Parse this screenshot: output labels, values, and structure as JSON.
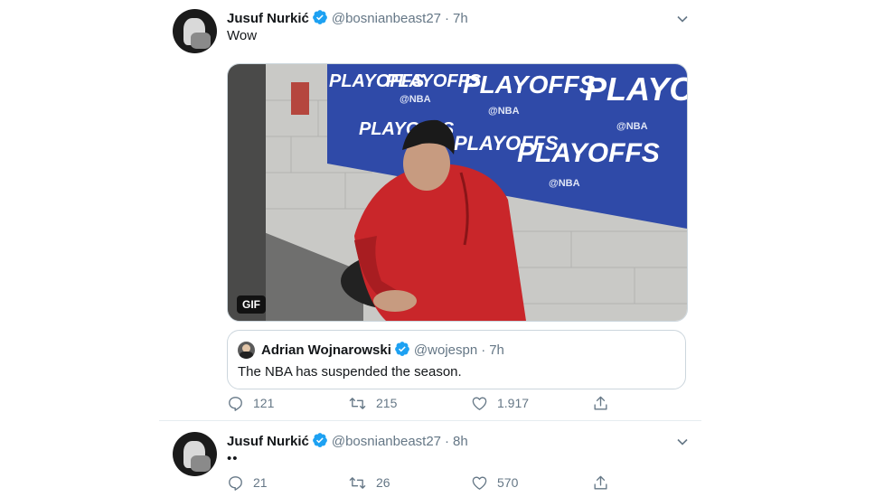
{
  "tweets": [
    {
      "author": "Jusuf Nurkić",
      "handle": "@bosnianbeast27",
      "separator": "·",
      "time": "7h",
      "text": "Wow",
      "media": {
        "badge": "GIF",
        "banner_texts": [
          "PLAYOFFS",
          "PLAYOFFS",
          "PLAYOFFS",
          "PLAYOFF",
          "PLAYOFFS",
          "PLAYOFFS",
          "PLAYOFFS"
        ],
        "banner_sub": [
          "@NBA",
          "@NBA",
          "@NBA",
          "@NBA"
        ]
      },
      "quote": {
        "author": "Adrian Wojnarowski",
        "handle": "@wojespn",
        "separator": "·",
        "time": "7h",
        "text": "The NBA has suspended the season."
      },
      "actions": {
        "replies": "121",
        "retweets": "215",
        "likes": "1.917"
      }
    },
    {
      "author": "Jusuf Nurkić",
      "handle": "@bosnianbeast27",
      "separator": "·",
      "time": "8h",
      "text": "••",
      "actions": {
        "replies": "21",
        "retweets": "26",
        "likes": "570"
      }
    }
  ],
  "colors": {
    "verified": "#1da1f2",
    "text": "#14171a",
    "muted": "#657786",
    "border": "#e6ecf0",
    "banner": "#2f4aa8"
  }
}
